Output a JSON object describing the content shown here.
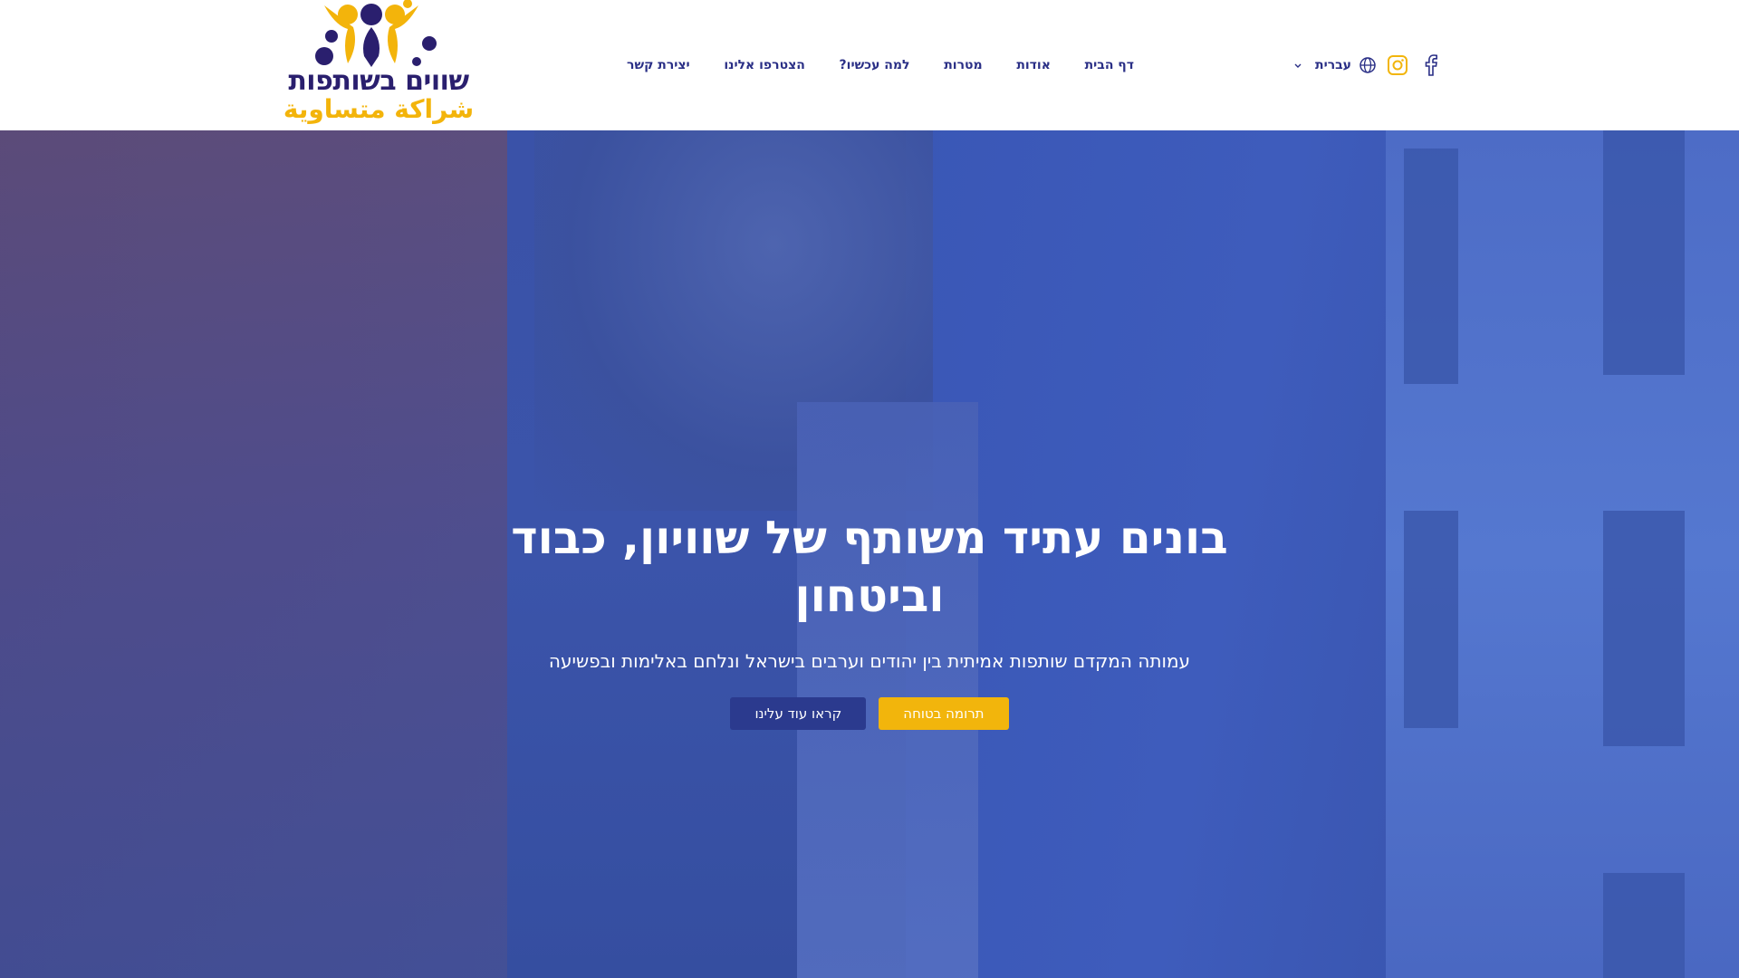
{
  "logo": {
    "hebrew": "שווים בשותפות",
    "arabic": "شراكة متساوية"
  },
  "nav": {
    "items": [
      {
        "label": "דף הבית"
      },
      {
        "label": "אודות"
      },
      {
        "label": "מטרות"
      },
      {
        "label": "למה עכשיו?"
      },
      {
        "label": "הצטרפו אלינו"
      },
      {
        "label": "יצירת קשר"
      }
    ]
  },
  "language": {
    "selected": "עברית",
    "icon": "globe-icon"
  },
  "social": {
    "instagram_icon": "instagram-icon",
    "facebook_icon": "facebook-icon"
  },
  "hero": {
    "title": "בונים עתיד משותף של שוויון, כבוד וביטחון",
    "subtitle": "עמותה המקדם שותפות אמיתית בין יהודים וערבים בישראל ונלחם באלימות ובפשיעה",
    "primary_button": "תרומה בטוחה",
    "secondary_button": "קראו עוד עלינו"
  },
  "colors": {
    "brand_navy": "#2a2f86",
    "brand_yellow": "#f2b50c",
    "logo_purple": "#2a1f6e",
    "hero_overlay_blue": "#3a56b0"
  }
}
